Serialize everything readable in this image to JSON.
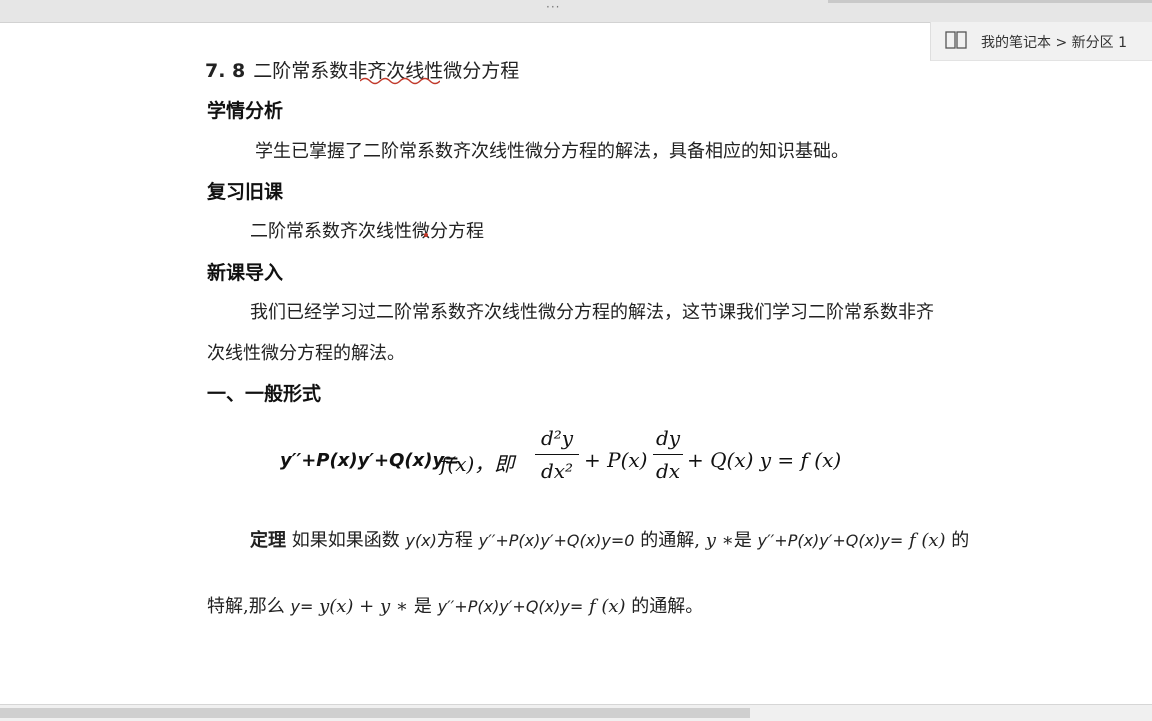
{
  "breadcrumb": {
    "notebook": "我的笔记本",
    "separator": ">",
    "section": "新分区 1",
    "icon": "notebook-icon"
  },
  "topbar": {
    "handle": "···"
  },
  "doc": {
    "title_num": "7. 8",
    "title_text": "二阶常系数非齐次线性微分方程",
    "h1": "学情分析",
    "p1": "学生已掌握了二阶常系数齐次线性微分方程的解法，具备相应的知识基础。",
    "h2": "复习旧课",
    "p2": "二阶常系数齐次线性微分方程",
    "h3": "新课导入",
    "p3a": "我们已经学习过二阶常系数齐次线性微分方程的解法，这节课我们学习二阶常系数非齐",
    "p3b": "次线性微分方程的解法。",
    "h4": "一、一般形式",
    "eq_left": "y′′+P(x)y′+Q(x)y=",
    "eq_fx": "f(x)，即",
    "eq_frac1_num": "d²y",
    "eq_frac1_den": "dx²",
    "eq_mid": "+ P(x)",
    "eq_frac2_num": "dy",
    "eq_frac2_den": "dx",
    "eq_tail": "+ Q(x) y = f (x)",
    "theorem_label": "定理",
    "theorem_l1_a": "如果如果函数",
    "theorem_l1_yx": "y(x)",
    "theorem_l1_b": "方程",
    "theorem_l1_eq": "y′′+P(x)y′+Q(x)y=0",
    "theorem_l1_c": "的通解,",
    "theorem_l1_ystar": "y ∗",
    "theorem_l1_d": "是",
    "theorem_l1_eq2": "y′′+P(x)y′+Q(x)y=",
    "theorem_l1_fx": "f (x)",
    "theorem_l1_e": "的",
    "theorem_l2_a": "特解,那么",
    "theorem_l2_y": "y=",
    "theorem_l2_sum": "y(x) + y ∗",
    "theorem_l2_b": "是",
    "theorem_l2_eq": "y′′+P(x)y′+Q(x)y=",
    "theorem_l2_fx": "f (x)",
    "theorem_l2_c": "的通解。"
  }
}
